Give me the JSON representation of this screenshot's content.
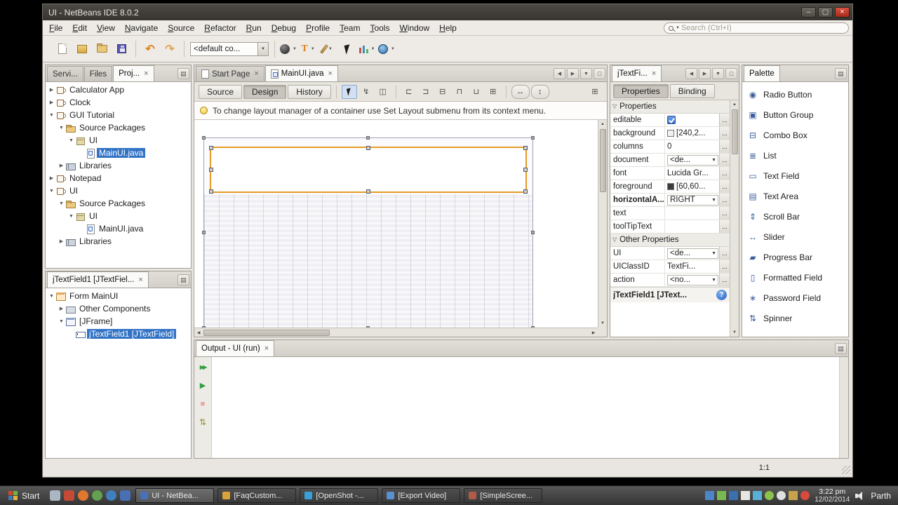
{
  "window": {
    "title": "UI - NetBeans IDE 8.0.2"
  },
  "menubar": {
    "items": [
      "File",
      "Edit",
      "View",
      "Navigate",
      "Source",
      "Refactor",
      "Run",
      "Debug",
      "Profile",
      "Team",
      "Tools",
      "Window",
      "Help"
    ],
    "search_placeholder": "Search (Ctrl+I)"
  },
  "toolbar": {
    "config_value": "<default co..."
  },
  "projects_panel": {
    "tabs": [
      {
        "label": "Servi..."
      },
      {
        "label": "Files"
      },
      {
        "label": "Proj...",
        "active": true,
        "closable": true
      }
    ],
    "tree": [
      {
        "level": 0,
        "toggle": "collapsed",
        "icon": "project",
        "label": "Calculator App"
      },
      {
        "level": 0,
        "toggle": "collapsed",
        "icon": "project",
        "label": "Clock"
      },
      {
        "level": 0,
        "toggle": "expanded",
        "icon": "project",
        "label": "GUI Tutorial"
      },
      {
        "level": 1,
        "toggle": "expanded",
        "icon": "folder",
        "label": "Source Packages"
      },
      {
        "level": 2,
        "toggle": "expanded",
        "icon": "package",
        "label": "UI"
      },
      {
        "level": 3,
        "toggle": "none",
        "icon": "java",
        "label": "MainUI.java",
        "selected": true
      },
      {
        "level": 1,
        "toggle": "collapsed",
        "icon": "libraries",
        "label": "Libraries"
      },
      {
        "level": 0,
        "toggle": "collapsed",
        "icon": "project",
        "label": "Notepad"
      },
      {
        "level": 0,
        "toggle": "expanded",
        "icon": "project",
        "label": "UI"
      },
      {
        "level": 1,
        "toggle": "expanded",
        "icon": "folder",
        "label": "Source Packages"
      },
      {
        "level": 2,
        "toggle": "expanded",
        "icon": "package",
        "label": "UI"
      },
      {
        "level": 3,
        "toggle": "none",
        "icon": "java",
        "label": "MainUI.java"
      },
      {
        "level": 1,
        "toggle": "collapsed",
        "icon": "libraries",
        "label": "Libraries"
      }
    ]
  },
  "navigator_panel": {
    "tab": "jTextField1 [JTextFiel...",
    "tree": [
      {
        "level": 0,
        "toggle": "expanded",
        "icon": "form",
        "label": "Form MainUI"
      },
      {
        "level": 1,
        "toggle": "collapsed",
        "icon": "components",
        "label": "Other Components"
      },
      {
        "level": 1,
        "toggle": "expanded",
        "icon": "frame",
        "label": "[JFrame]"
      },
      {
        "level": 2,
        "toggle": "none",
        "icon": "textfield",
        "label": "jTextField1 [JTextField]",
        "selected": true
      }
    ]
  },
  "editor": {
    "tabs": [
      {
        "label": "Start Page",
        "icon": "page",
        "closable": true
      },
      {
        "label": "MainUI.java",
        "icon": "java",
        "active": true,
        "closable": true
      }
    ],
    "views": [
      {
        "label": "Source"
      },
      {
        "label": "Design",
        "active": true
      },
      {
        "label": "History"
      }
    ],
    "hint": "To change layout manager of a container use Set Layout submenu from its context menu."
  },
  "properties_panel": {
    "tab": "jTextFi...",
    "views": [
      {
        "label": "Properties",
        "active": true
      },
      {
        "label": "Binding"
      }
    ],
    "rows": [
      {
        "type": "section",
        "label": "Properties"
      },
      {
        "type": "checkbox",
        "name": "editable",
        "checked": true,
        "value": ""
      },
      {
        "type": "color",
        "name": "background",
        "value": "[240,2...",
        "swatch": "#f0f0f0"
      },
      {
        "type": "text",
        "name": "columns",
        "value": "0"
      },
      {
        "type": "combo",
        "name": "document",
        "value": "<de..."
      },
      {
        "type": "text",
        "name": "font",
        "value": "Lucida Gr..."
      },
      {
        "type": "color",
        "name": "foreground",
        "value": "[60,60...",
        "swatch": "#3c3c3c"
      },
      {
        "type": "combo",
        "name": "horizontalA...",
        "value": "RIGHT",
        "bold": true
      },
      {
        "type": "text",
        "name": "text",
        "value": ""
      },
      {
        "type": "text",
        "name": "toolTipText",
        "value": ""
      },
      {
        "type": "section",
        "label": "Other Properties"
      },
      {
        "type": "combo",
        "name": "UI",
        "value": "<de..."
      },
      {
        "type": "text",
        "name": "UIClassID",
        "value": "TextFi..."
      },
      {
        "type": "combo",
        "name": "action",
        "value": "<no..."
      }
    ],
    "status": "jTextField1 [JText..."
  },
  "palette": {
    "tab": "Palette",
    "items": [
      {
        "label": "Radio Button",
        "icon": "radio-button-icon",
        "glyph": "◉"
      },
      {
        "label": "Button Group",
        "icon": "button-group-icon",
        "glyph": "▣"
      },
      {
        "label": "Combo Box",
        "icon": "combo-box-icon",
        "glyph": "⊟"
      },
      {
        "label": "List",
        "icon": "list-icon",
        "glyph": "≣"
      },
      {
        "label": "Text Field",
        "icon": "text-field-icon",
        "glyph": "▭"
      },
      {
        "label": "Text Area",
        "icon": "text-area-icon",
        "glyph": "▤"
      },
      {
        "label": "Scroll Bar",
        "icon": "scroll-bar-icon",
        "glyph": "⇕"
      },
      {
        "label": "Slider",
        "icon": "slider-icon",
        "glyph": "↔"
      },
      {
        "label": "Progress Bar",
        "icon": "progress-bar-icon",
        "glyph": "▰"
      },
      {
        "label": "Formatted Field",
        "icon": "formatted-field-icon",
        "glyph": "▯"
      },
      {
        "label": "Password Field",
        "icon": "password-field-icon",
        "glyph": "∗"
      },
      {
        "label": "Spinner",
        "icon": "spinner-icon",
        "glyph": "⇅"
      }
    ]
  },
  "output_panel": {
    "tab": "Output - UI (run)"
  },
  "statusbar": {
    "caret": "1:1"
  },
  "taskbar": {
    "start_label": "Start",
    "quick_launch": [
      {
        "name": "keyboard-layout-icon",
        "color": "#aab6c2"
      },
      {
        "name": "file-manager-icon",
        "color": "#c34a36"
      },
      {
        "name": "firefox-icon",
        "color": "#e2772e",
        "shape": "circle"
      },
      {
        "name": "software-center-icon",
        "color": "#63a14e",
        "shape": "circle"
      },
      {
        "name": "kde-launcher-icon",
        "color": "#3f7fbf",
        "shape": "circle"
      },
      {
        "name": "netbeans-quick-icon",
        "color": "#4a6fb5"
      }
    ],
    "windows": [
      {
        "label": "UI - NetBea...",
        "active": true,
        "color": "#4a70b8"
      },
      {
        "label": "[FaqCustom...",
        "color": "#d9a23a"
      },
      {
        "label": "[OpenShot -...",
        "color": "#3aa0d9"
      },
      {
        "label": "[Export Video]",
        "color": "#5a8fd0"
      },
      {
        "label": "[SimpleScree...",
        "color": "#b05a4a"
      }
    ],
    "tray": [
      {
        "name": "chat-icon",
        "color": "#4c86c8"
      },
      {
        "name": "update-manager-icon",
        "color": "#79b951"
      },
      {
        "name": "bluetooth-icon",
        "color": "#3a6fb0"
      },
      {
        "name": "clipboard-icon",
        "color": "#e8e6e0"
      },
      {
        "name": "display-icon",
        "color": "#58b0d8"
      },
      {
        "name": "messaging-icon",
        "color": "#8bc34a",
        "shape": "circle"
      },
      {
        "name": "wifi-icon",
        "color": "#e0e0e0",
        "shape": "circle"
      },
      {
        "name": "time-sync-icon",
        "color": "#c8a24a"
      },
      {
        "name": "recording-icon",
        "color": "#d84a3a",
        "shape": "circle"
      }
    ],
    "clock_time": "3:22 pm",
    "clock_date": "12/02/2014",
    "user": "Parth"
  },
  "icons": {
    "minimize": "–",
    "maximize": "▢",
    "close": "×",
    "dropdown": "▼",
    "scroll-left": "◀",
    "scroll-right": "▶",
    "scroll-up": "▲",
    "scroll-down": "▼",
    "maximize-view": "▢",
    "panel-menu": "▤",
    "expanded": "▼",
    "collapsed": "▶",
    "section-arrow": "▽",
    "undo": "↶",
    "redo": "↷",
    "ellipsis": "...",
    "connection-mode": "↯",
    "preview-form": "◫",
    "align-left": "⊏",
    "align-right": "⊐",
    "center-horizontal": "⊟",
    "align-top": "⊓",
    "align-bottom": "⊔",
    "center-vertical": "⊞",
    "h-resize": "↔",
    "v-resize": "↕",
    "grid": "⊞",
    "rerun": "▶▶",
    "rerun-debug": "▶",
    "stop": "■",
    "ant": "⇅",
    "help": "?",
    "profile-T": "T"
  }
}
